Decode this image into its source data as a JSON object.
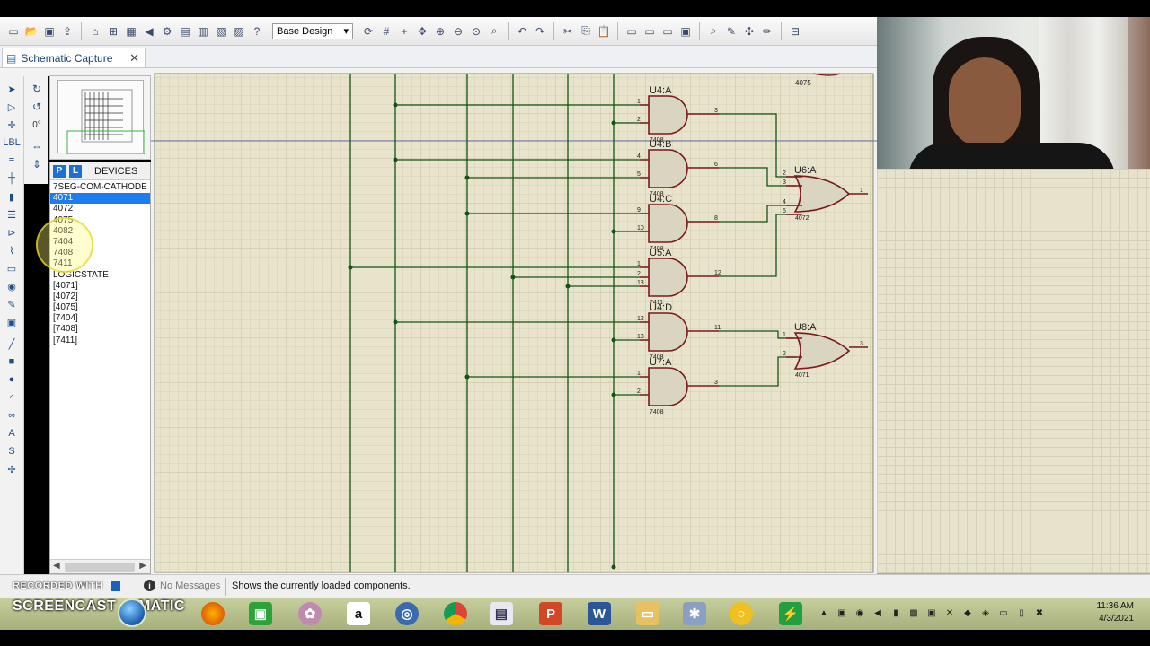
{
  "toolbar": {
    "design_select": "Base Design",
    "icons": [
      "new-icon",
      "open-icon",
      "save-icon",
      "import-icon",
      "home-icon",
      "schematic-icon",
      "pcb-icon",
      "back-icon",
      "forward-icon",
      "gerber-icon",
      "bom-icon",
      "notes-icon",
      "help-icon"
    ]
  },
  "tab": {
    "label": "Schematic Capture"
  },
  "left_tools": {
    "rotation": "0°"
  },
  "devices": {
    "p_label": "P",
    "l_label": "L",
    "title": "DEVICES",
    "items": [
      "7SEG-COM-CATHODE",
      "4071",
      "4072",
      "4075",
      "4082",
      "7404",
      "7408",
      "7411",
      "LOGICSTATE",
      "[4071]",
      "[4072]",
      "[4075]",
      "[7404]",
      "[7408]",
      "[7411]"
    ],
    "selected_index": 1
  },
  "schematic": {
    "gates": [
      {
        "ref": "U4:A",
        "part": "7408",
        "pin_in1": "1",
        "pin_in2": "2",
        "pin_out": "3"
      },
      {
        "ref": "U4:B",
        "part": "7408",
        "pin_in1": "4",
        "pin_in2": "5",
        "pin_out": "6"
      },
      {
        "ref": "U4:C",
        "part": "7408",
        "pin_in1": "9",
        "pin_in2": "10",
        "pin_out": "8"
      },
      {
        "ref": "U5:A",
        "part": "7411",
        "pin_in1": "1",
        "pin_in2": "2",
        "pin_in3": "13",
        "pin_out": "12"
      },
      {
        "ref": "U4:D",
        "part": "7408",
        "pin_in1": "12",
        "pin_in2": "13",
        "pin_out": "11"
      },
      {
        "ref": "U7:A",
        "part": "7408",
        "pin_in1": "1",
        "pin_in2": "2",
        "pin_out": "3"
      },
      {
        "ref": "U6:A",
        "part": "4072",
        "pin_in1": "2",
        "pin_in2": "3",
        "pin_in3": "4",
        "pin_in4": "5",
        "pin_out": "1"
      },
      {
        "ref": "U8:A",
        "part": "4071",
        "pin_in1": "1",
        "pin_in2": "2",
        "pin_out": "3"
      }
    ],
    "top_part_label": "4075"
  },
  "status": {
    "recorded": "RECORDED WITH",
    "messages": "No Messages",
    "hint": "Shows the currently loaded components."
  },
  "taskbar": {
    "screencast": "SCREENCAST",
    "matic": "MATIC",
    "time": "11:36 AM",
    "date": "4/3/2021"
  }
}
